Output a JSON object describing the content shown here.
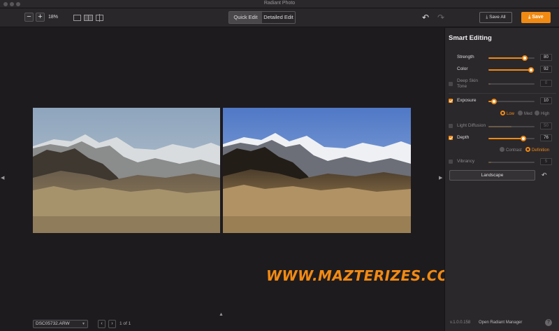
{
  "window": {
    "title": "Radiant Photo"
  },
  "toolbar": {
    "zoom_out_label": "−",
    "zoom_in_label": "+",
    "zoom_level": "18%",
    "mode_tabs": [
      {
        "label": "Quick Edit",
        "active": true
      },
      {
        "label": "Detailed Edit",
        "active": false
      }
    ],
    "undo_icon": "undo-icon",
    "redo_icon": "redo-icon",
    "save_all_label": "Save All",
    "save_label": "Save"
  },
  "canvas": {
    "watermark": "WWW.MAZTERIZES.COM",
    "file_name": "DSC05732.ARW",
    "pager": "1 of 1"
  },
  "panel": {
    "title": "Smart Editing",
    "sliders": [
      {
        "label": "Strength",
        "value": "80",
        "enabled": true
      },
      {
        "label": "Color",
        "value": "92",
        "enabled": true
      },
      {
        "label": "Deep Skin Tone",
        "value": "0",
        "enabled": false
      },
      {
        "label": "Exposure",
        "value": "10",
        "enabled": true
      },
      {
        "label": "Light Diffusion",
        "value": "50",
        "enabled": false
      },
      {
        "label": "Depth",
        "value": "76",
        "enabled": true
      },
      {
        "label": "Vibrancy",
        "value": "5",
        "enabled": false
      }
    ],
    "exposure_options": [
      {
        "label": "Low",
        "selected": true
      },
      {
        "label": "Med",
        "selected": false
      },
      {
        "label": "High",
        "selected": false
      }
    ],
    "depth_options": [
      {
        "label": "Contrast",
        "selected": false
      },
      {
        "label": "Definition",
        "selected": true
      }
    ],
    "preset_label": "Landscape",
    "version": "v.1.0.0.158",
    "manager_link": "Open Radiant Manager",
    "help_label": "?"
  },
  "colors": {
    "accent": "#f08a12",
    "panel_bg": "#2b282c",
    "canvas_bg": "#1e1b1f"
  }
}
